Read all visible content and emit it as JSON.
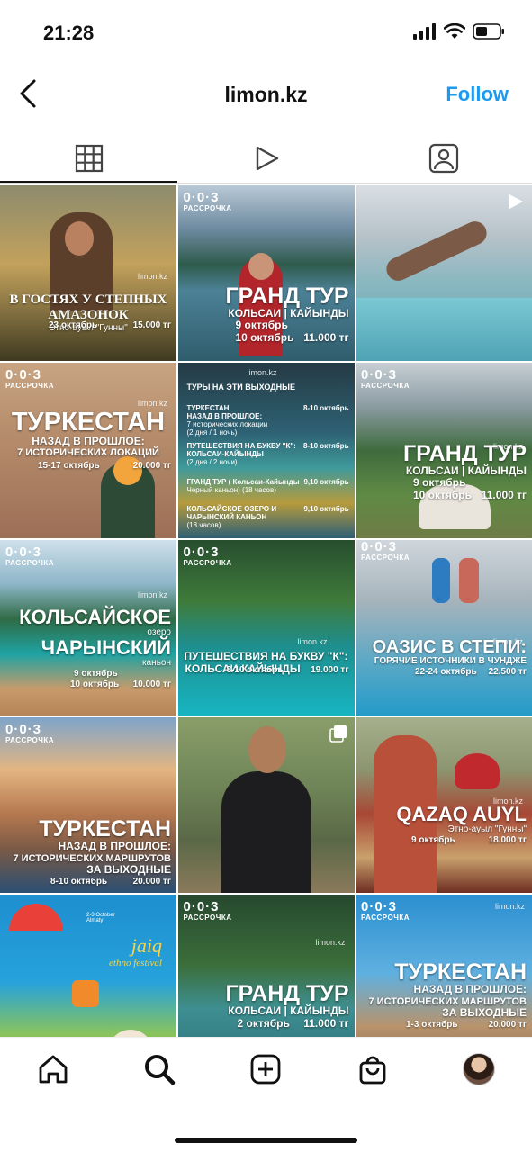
{
  "status": {
    "time": "21:28"
  },
  "header": {
    "title": "limon.kz",
    "follow_label": "Follow"
  },
  "brand": {
    "logo": "0·0·3",
    "sub": "РАССРОЧКА",
    "watermark": "limon.kz"
  },
  "tiles": [
    {
      "line1": "В ГОСТЯХ У СТЕПНЫХ",
      "line2": "АМАЗОНОК",
      "line3": "Этно-ауыл \"Гунны\"",
      "date": "23 октябрь",
      "price": "15.000 тг"
    },
    {
      "big": "ГРАНД ТУР",
      "sub": "КОЛЬСАИ | КАЙЫНДЫ",
      "date1": "9 октябрь",
      "date2": "10 октябрь",
      "price": "11.000 тг"
    },
    {},
    {
      "big": "ТУРКЕСТАН",
      "sub1": "НАЗАД В ПРОШЛОЕ:",
      "sub2": "7 ИСТОРИЧЕСКИХ ЛОКАЦИЙ",
      "date": "15-17 октябрь",
      "price": "20.000 тг"
    },
    {
      "heading": "ТУРЫ НА ЭТИ ВЫХОДНЫЕ",
      "items": [
        {
          "text": "ТУРКЕСТАН",
          "sub1": "НАЗАД В ПРОШЛОЕ:",
          "sub2": "7 исторических локации",
          "sub3": "(2 дня / 1 ночь)",
          "date": "8-10 октябрь"
        },
        {
          "text": "ПУТЕШЕСТВИЯ НА БУКВУ \"К\":",
          "sub1": "КОЛЬСАИ-КАЙЫНДЫ",
          "sub2": "(2 дня / 2 ночи)",
          "sub3": "",
          "date": "8-10 октябрь"
        },
        {
          "text": "ГРАНД ТУР ( Кольсаи-Кайынды",
          "sub1": "Черный каньон) (18 часов)",
          "sub2": "",
          "sub3": "",
          "date": "9,10 октябрь"
        },
        {
          "text": "КОЛЬСАЙСКОЕ ОЗЕРО И",
          "sub1": "ЧАРЫНСКИЙ КАНЬОН",
          "sub2": "(18 часов)",
          "sub3": "",
          "date": "9,10 октябрь"
        }
      ]
    },
    {
      "big": "ГРАНД ТУР",
      "sub": "КОЛЬСАИ | КАЙЫНДЫ",
      "date1": "9 октябрь",
      "date2": "10 октябрь",
      "price": "11.000 тг"
    },
    {
      "big1": "КОЛЬСАЙСКОЕ",
      "small1": "озеро",
      "big2": "ЧАРЫНСКИЙ",
      "small2": "каньон",
      "date1": "9 октябрь",
      "date2": "10 октябрь",
      "price": "10.000 тг"
    },
    {
      "line1": "ПУТЕШЕСТВИЯ НА БУКВУ \"К\":",
      "line2": "КОЛЬСАИ-КАЙЫНДЫ",
      "date": "8-10 октябрь",
      "price": "19.000 тг"
    },
    {
      "big": "ОАЗИС В СТЕПИ:",
      "sub": "ГОРЯЧИЕ ИСТОЧНИКИ В ЧУНДЖЕ",
      "date": "22-24 октябрь",
      "price": "22.500 тг"
    },
    {
      "big": "ТУРКЕСТАН",
      "sub1": "НАЗАД В ПРОШЛОЕ:",
      "sub2": "7 ИСТОРИЧЕСКИХ МАРШРУТОВ",
      "sub3": "ЗА ВЫХОДНЫЕ",
      "date": "8-10 октябрь",
      "price": "20.000 тг"
    },
    {},
    {
      "big": "QAZAQ AUYL",
      "sub": "Этно-ауыл \"Гунны\"",
      "date": "9 октябрь",
      "price": "18.000 тг"
    },
    {
      "title1": "jaiq",
      "title2": "ethno festival",
      "note": "2-3 October Almaty"
    },
    {
      "big": "ГРАНД ТУР",
      "sub": "КОЛЬСАИ | КАЙЫНДЫ",
      "date": "2 октябрь",
      "price": "11.000 тг"
    },
    {
      "big": "ТУРКЕСТАН",
      "sub1": "НАЗАД В ПРОШЛОЕ:",
      "sub2": "7 ИСТОРИЧЕСКИХ МАРШРУТОВ",
      "sub3": "ЗА ВЫХОДНЫЕ",
      "date": "1-3 октябрь",
      "price": "20.000 тг"
    }
  ],
  "icons": {
    "back": "chevron-left-icon",
    "grid": "grid-icon",
    "reels": "play-icon",
    "tagged": "tagged-icon",
    "home": "home-icon",
    "search": "search-icon",
    "create": "plus-square-icon",
    "shop": "shopping-bag-icon",
    "profile": "avatar"
  },
  "colors": {
    "follow": "#1a9af0",
    "text": "#111111"
  }
}
